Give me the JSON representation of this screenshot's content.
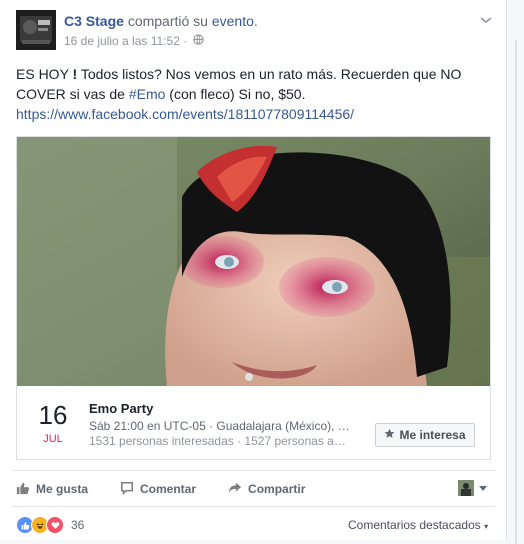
{
  "post": {
    "author": "C3 Stage",
    "verb": "compartió su",
    "object_link": "evento",
    "object_suffix": ".",
    "timestamp": "16 de julio a las 11:52 ·",
    "privacy_icon": "globe-icon",
    "body_part1": "ES HOY ",
    "body_bold": "!",
    "body_part2": " Todos listos? Nos vemos en un rato más. Recuerden que NO COVER si vas de ",
    "hashtag": "#Emo",
    "body_part3": " (con fleco) Si no, $50.",
    "url": "https://www.facebook.com/events/1811077809114456/"
  },
  "event": {
    "day": "16",
    "month": "JUL",
    "title": "Emo Party",
    "line1": "Sáb 21:00 en UTC-05 · Guadalajara (México), …",
    "line2": "1531 personas interesadas · 1527 personas a…",
    "interest_button": "Me interesa",
    "interest_icon": "star-icon"
  },
  "actions": {
    "like": "Me gusta",
    "comment": "Comentar",
    "share": "Compartir"
  },
  "reactions": {
    "count": "36",
    "types": [
      "like",
      "haha",
      "love"
    ],
    "colors": {
      "like": "#5890ff",
      "haha": "#f7b125",
      "love": "#f25268"
    }
  },
  "top_comments": "Comentarios destacados",
  "colors": {
    "link": "#365899",
    "accent_month": "#e0245e"
  }
}
